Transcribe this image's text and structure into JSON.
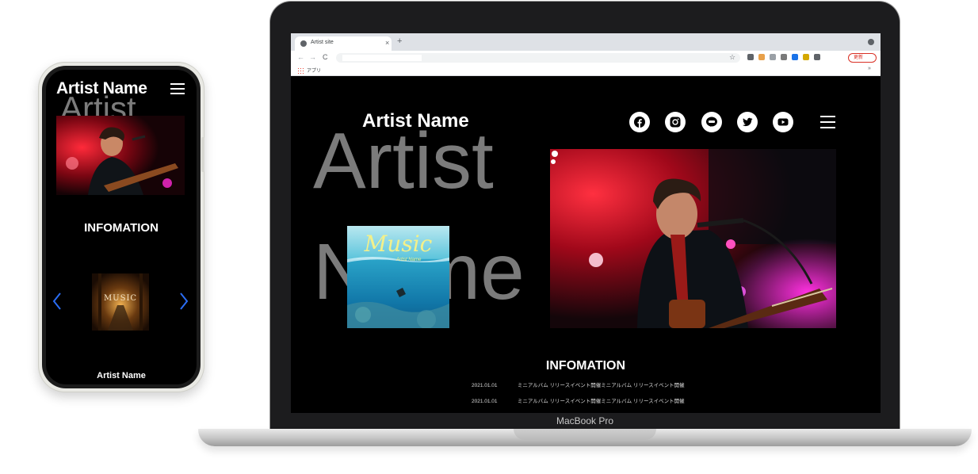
{
  "phone": {
    "title": "Artist Name",
    "bg_text": "Artist",
    "section_title": "INFOMATION",
    "album_art_text": "MUSIC",
    "footer_text": "Artist Name",
    "icons": [
      "hamburger-menu-icon",
      "chevron-left-icon",
      "chevron-right-icon"
    ],
    "arrow_color": "#2a6df4"
  },
  "laptop": {
    "label": "MacBook Pro",
    "browser": {
      "tab_title": "Artist site",
      "tab_close": "×",
      "new_tab": "+",
      "bookmarks_label": "アプリ",
      "bookmarks_more": "»",
      "update_label": "更新",
      "nav_back": "←",
      "nav_forward": "→",
      "nav_reload": "C",
      "star": "☆"
    },
    "site": {
      "title": "Artist Name",
      "bg_word_1": "Artist",
      "bg_word_2": "Name",
      "album_title": "Music",
      "album_subtitle": "Artist Name",
      "social": [
        "facebook-icon",
        "instagram-icon",
        "line-icon",
        "twitter-icon",
        "youtube-icon"
      ],
      "section_title": "INFOMATION",
      "news": [
        {
          "date": "2021.01.01",
          "text": "ミニアルバム リリースイベント開催ミニアルバム リリースイベント開催"
        },
        {
          "date": "2021.01.01",
          "text": "ミニアルバム リリースイベント開催ミニアルバム リリースイベント開催"
        }
      ]
    }
  },
  "colors": {
    "site_bg": "#000000",
    "bg_text": "#7b7b7b",
    "accent_red": "#e0102a",
    "update_red": "#d93025"
  }
}
